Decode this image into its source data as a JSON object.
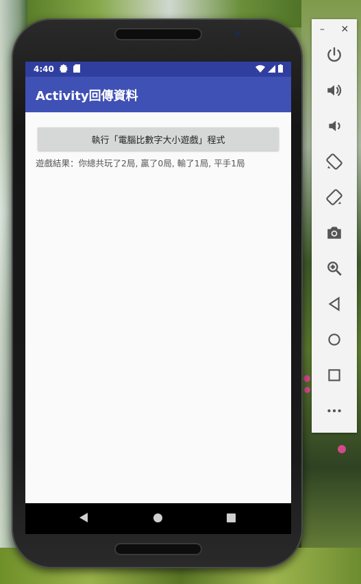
{
  "statusbar": {
    "time": "4:40"
  },
  "appbar": {
    "title": "Activity回傳資料"
  },
  "main": {
    "run_button_label": "執行「電腦比數字大小遊戲」程式",
    "result_text": "遊戲結果：你總共玩了2局, 贏了0局, 輸了1局, 平手1局"
  },
  "toolbar": {
    "minimize_label": "–",
    "close_label": "✕",
    "items": [
      "power-icon",
      "volume-up-icon",
      "volume-down-icon",
      "rotate-left-icon",
      "rotate-right-icon",
      "camera-icon",
      "zoom-icon",
      "back-icon",
      "home-icon",
      "overview-icon",
      "more-icon"
    ]
  },
  "colors": {
    "status_bar": "#303f9f",
    "app_bar": "#3f51b5",
    "content_bg": "#fafafa",
    "button_bg": "#d6d7d7"
  }
}
